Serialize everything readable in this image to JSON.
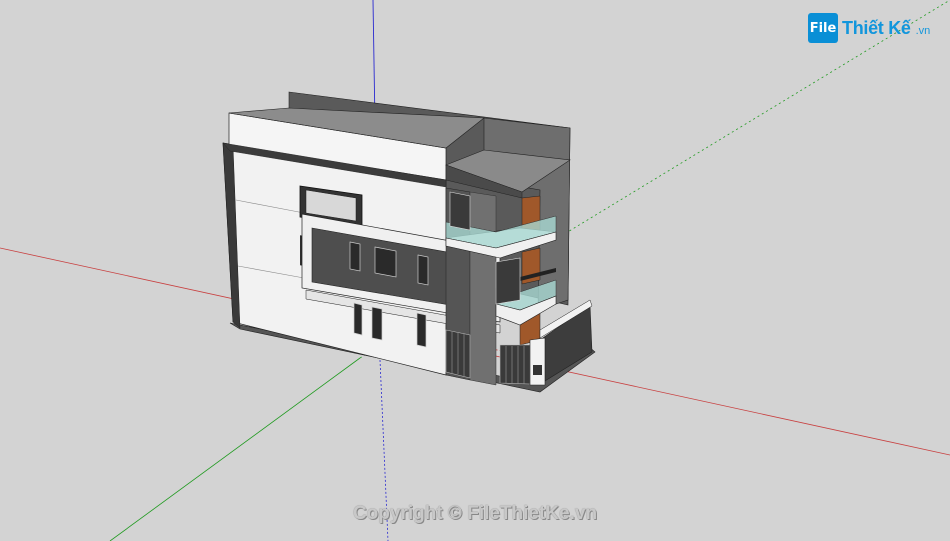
{
  "logo": {
    "badge": "File",
    "name": "Thiết Kế",
    "domain": ".vn"
  },
  "watermark": {
    "copyright": "Copyright © FileThietKe.vn"
  },
  "colors": {
    "background": "#d3d3d3",
    "axis_red": "#c84040",
    "axis_green": "#1f9a1f",
    "axis_blue": "#2a2ad0",
    "brand_blue": "#1296dc",
    "wall_white": "#f2f2f2",
    "wall_dark": "#4a4a4a",
    "wood": "#a0582a",
    "glass": "#a8d8d2",
    "stone": "#6a6a6a"
  }
}
